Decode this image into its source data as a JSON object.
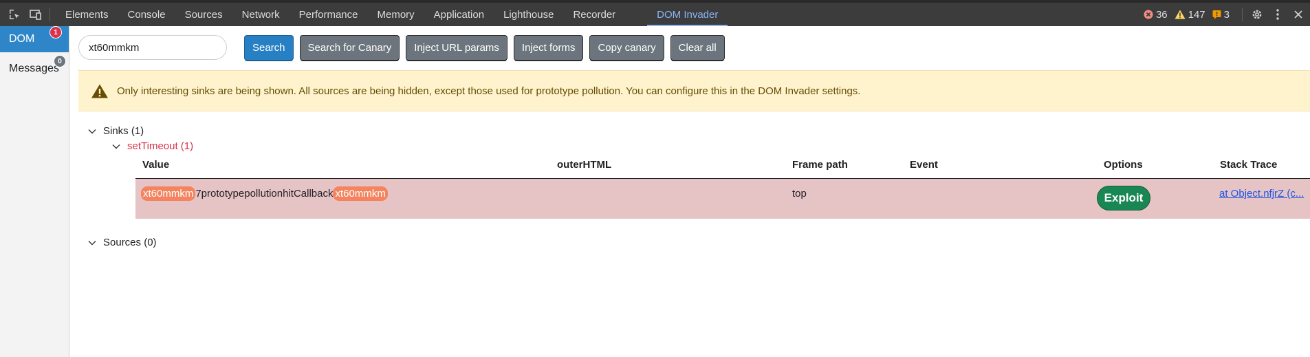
{
  "devtools": {
    "tabs": [
      "Elements",
      "Console",
      "Sources",
      "Network",
      "Performance",
      "Memory",
      "Application",
      "Lighthouse",
      "Recorder",
      "DOM Invader"
    ],
    "active_tab": "DOM Invader",
    "errors": "36",
    "warnings": "147",
    "issues": "3"
  },
  "sidebar": {
    "items": [
      {
        "label": "DOM",
        "badge": "1"
      },
      {
        "label": "Messages",
        "badge": "0"
      }
    ]
  },
  "toolbar": {
    "search_value": "xt60mmkm",
    "buttons": [
      "Search",
      "Search for Canary",
      "Inject URL params",
      "Inject forms",
      "Copy canary",
      "Clear all"
    ]
  },
  "warning": {
    "text": "Only interesting sinks are being shown. All sources are being hidden, except those used for prototype pollution. You can configure this in the DOM Invader settings."
  },
  "tree": {
    "sinks_label": "Sinks (1)",
    "sink_name": "setTimeout (1)",
    "sources_label": "Sources (0)"
  },
  "table": {
    "headers": [
      "Value",
      "outerHTML",
      "Frame path",
      "Event",
      "Options",
      "Stack Trace"
    ],
    "row": {
      "canary_prefix": "xt60mmkm",
      "middle": "7prototypepollutionhitCallback",
      "canary_suffix": "xt60mmkm",
      "outer_html": "",
      "frame_path": "top",
      "event": "",
      "option_button": "Exploit",
      "stack_trace": "at Object.nfjrZ (c..."
    }
  },
  "colors": {
    "topbar": "#3c3c3c",
    "active_tab": "#8ab4f8",
    "primary_button": "#2780c4",
    "gray_button": "#6c757d",
    "warning_bg": "#fff3cd",
    "row_bg": "#e6c4c6",
    "canary": "#f4845f",
    "exploit": "#198754",
    "sink_red": "#d93249"
  }
}
